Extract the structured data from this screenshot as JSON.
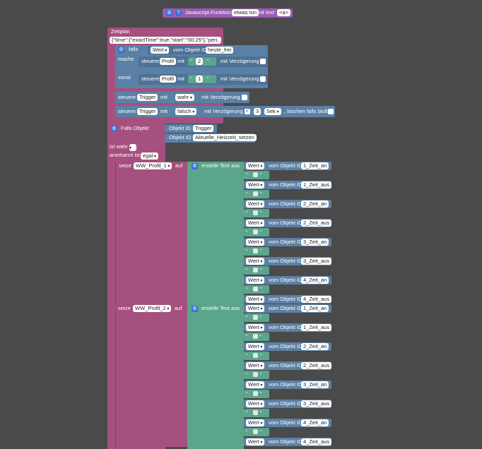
{
  "function_header": {
    "label": "Javascript-Funktion",
    "name": "etwas tun",
    "with_text": "mit text",
    "param": "<a>"
  },
  "schedule": {
    "title": "Zeitplan",
    "expr": "{\"time\":{\"exactTime\":true,\"start\":\"00:25\"},\"peri..."
  },
  "if_block": {
    "falls": "falls",
    "wert": "Wert",
    "vom_objekt_id": "vom Objekt ID",
    "id": "heute_frei",
    "mache": "mache",
    "sonst": "sonst",
    "steuere": "steuere",
    "profil": "Profil",
    "mit": "mit",
    "v2": "2",
    "v1": "1",
    "delay": "mit Verzögerung"
  },
  "trigger_rows": [
    {
      "steuere": "steuere",
      "target": "Trigger",
      "mit": "mit",
      "value": "wahr",
      "delay": "mit Verzögerung"
    },
    {
      "steuere": "steuere",
      "target": "Trigger",
      "mit": "mit",
      "value": "falsch",
      "delay": "mit Verzögerung",
      "check": "✓",
      "amount": "3",
      "unit": "Sek",
      "clear": ", löschen falls läuft"
    }
  ],
  "falls_objekt": {
    "title": "Falls Objekt",
    "obj_label": "Objekt ID",
    "obj1": "Trigger",
    "obj2": "Aktuelle_Heizzeit_setzen",
    "ist": "ist wahr",
    "anerkannt": "anerkannt ist",
    "egal": "egal"
  },
  "set_blocks": [
    {
      "setze": "setze",
      "var": "WW_Profil_1",
      "auf": "auf",
      "create": "erstelle Text aus"
    },
    {
      "setze": "setze",
      "var": "WW_Profil_2",
      "auf": "auf",
      "create": "erstelle Text aus"
    }
  ],
  "value_rows": [
    {
      "wert": "Wert",
      "vom": "vom Objekt ID",
      "id": "1_Zeit_an"
    },
    {
      "wert": "Wert",
      "vom": "vom Objekt ID",
      "id": "1_Zeit_aus"
    },
    {
      "wert": "Wert",
      "vom": "vom Objekt ID",
      "id": "2_Zeit_an"
    },
    {
      "wert": "Wert",
      "vom": "vom Objekt ID",
      "id": "2_Zeit_aus"
    },
    {
      "wert": "Wert",
      "vom": "vom Objekt ID",
      "id": "3_Zeit_an"
    },
    {
      "wert": "Wert",
      "vom": "vom Objekt ID",
      "id": "3_Zeit_aus"
    },
    {
      "wert": "Wert",
      "vom": "vom Objekt ID",
      "id": "4_Zeit_an"
    },
    {
      "wert": "Wert",
      "vom": "vom Objekt ID",
      "id": "4_Zeit_aus"
    }
  ],
  "quote_open": "“",
  "quote_close": "”",
  "colors": {
    "background": "#4a4a4a",
    "event": "#a5507e",
    "logic": "#5b80a5",
    "text": "#5ba58c",
    "function": "#9a5cb4"
  }
}
